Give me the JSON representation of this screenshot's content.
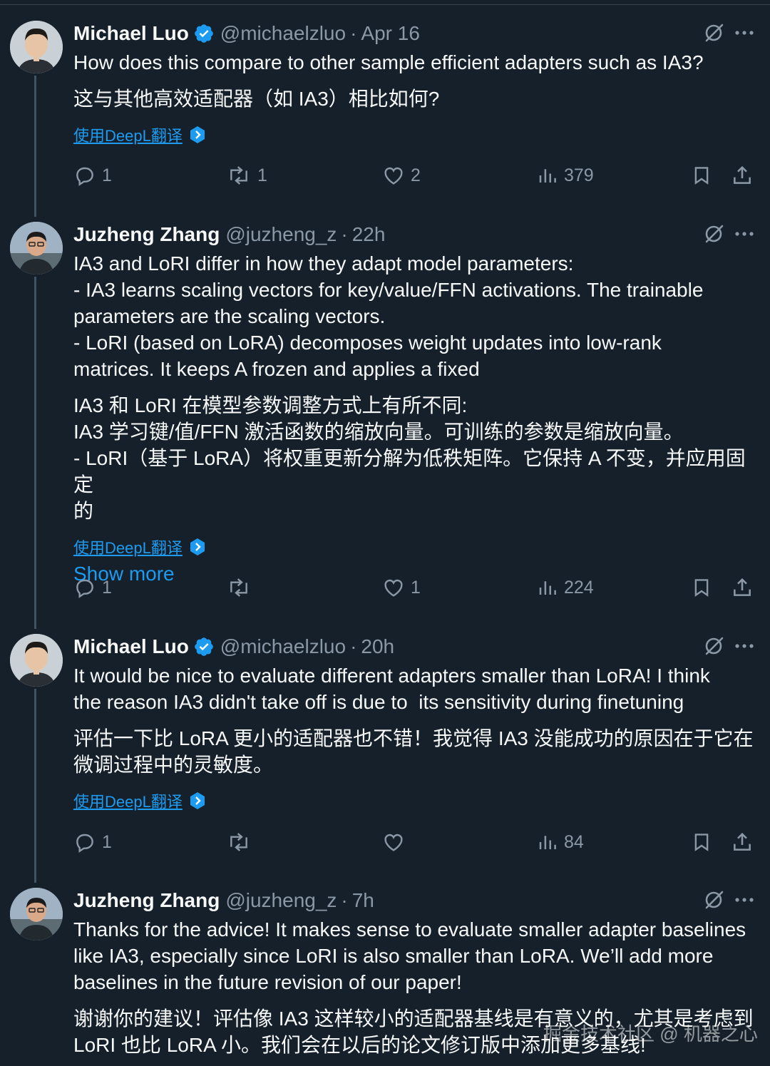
{
  "tweets": [
    {
      "name": "Michael Luo",
      "handle": "@michaelzluo",
      "time": "Apr 16",
      "verified": true,
      "text": "How does this compare to other sample efficient adapters such as IA3?",
      "text_zh": "这与其他高效适配器（如 IA3）相比如何?",
      "translate_label": "使用DeepL翻译",
      "show_more": "",
      "replies": "1",
      "retweets": "1",
      "likes": "2",
      "views": "379"
    },
    {
      "name": "Juzheng Zhang",
      "handle": "@juzheng_z",
      "time": "22h",
      "verified": false,
      "text": "IA3 and LoRI differ in how they adapt model parameters:\n- IA3 learns scaling vectors for key/value/FFN activations. The trainable\nparameters are the scaling vectors.\n- LoRI (based on LoRA) decomposes weight updates into low-rank\nmatrices. It keeps A frozen and applies a fixed",
      "text_zh": "IA3 和 LoRI 在模型参数调整方式上有所不同:\nIA3 学习键/值/FFN 激活函数的缩放向量。可训练的参数是缩放向量。\n- LoRI（基于 LoRA）将权重更新分解为低秩矩阵。它保持 A 不变，并应用固定\n的",
      "translate_label": "使用DeepL翻译",
      "show_more": "Show more",
      "replies": "1",
      "retweets": "",
      "likes": "1",
      "views": "224"
    },
    {
      "name": "Michael Luo",
      "handle": "@michaelzluo",
      "time": "20h",
      "verified": true,
      "text": "It would be nice to evaluate different adapters smaller than LoRA! I think\nthe reason IA3 didn't take off is due to  its sensitivity during finetuning",
      "text_zh": "评估一下比 LoRA 更小的适配器也不错！我觉得 IA3 没能成功的原因在于它在\n微调过程中的灵敏度。",
      "translate_label": "使用DeepL翻译",
      "show_more": "",
      "replies": "1",
      "retweets": "",
      "likes": "",
      "views": "84"
    },
    {
      "name": "Juzheng Zhang",
      "handle": "@juzheng_z",
      "time": "7h",
      "verified": false,
      "text": "Thanks for the advice! It makes sense to evaluate smaller adapter baselines\nlike IA3, especially since LoRI is also smaller than LoRA. We’ll add more\nbaselines in the future revision of our paper!",
      "text_zh": "谢谢你的建议！评估像 IA3 这样较小的适配器基线是有意义的，尤其是考虑到\nLoRI 也比 LoRA 小。我们会在以后的论文修订版中添加更多基线!",
      "translate_label": "",
      "show_more": "",
      "replies": "",
      "retweets": "",
      "likes": "",
      "views": ""
    }
  ],
  "watermark": "掘金技术社区 @ 机器之心",
  "colors": {
    "background": "#15202b",
    "text": "#f7f9f9",
    "secondary": "#8b98a5",
    "link": "#1d9bf0",
    "verified": "#1d9bf0"
  },
  "icons": [
    "verified-badge-icon",
    "grok-icon",
    "more-icon",
    "deepl-icon",
    "reply-icon",
    "retweet-icon",
    "like-icon",
    "views-icon",
    "bookmark-icon",
    "share-icon"
  ]
}
